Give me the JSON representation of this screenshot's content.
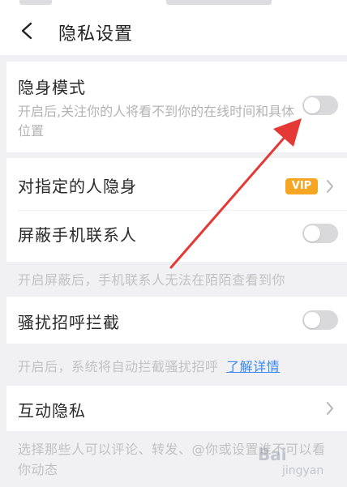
{
  "header": {
    "title": "隐私设置",
    "back_icon": "chevron-left-icon"
  },
  "items": {
    "incognito": {
      "label": "隐身模式",
      "desc": "开启后,关注你的人将看不到你的在线时间和具体位置",
      "toggle_on": false
    },
    "hide_from_people": {
      "label": "对指定的人隐身",
      "badge": "VIP",
      "badge_color": "#f5a623"
    },
    "block_contacts": {
      "label": "屏蔽手机联系人",
      "toggle_on": false,
      "note": "开启屏蔽后，手机联系人无法在陌陌查看到你"
    },
    "harassment": {
      "label": "骚扰招呼拦截",
      "toggle_on": false,
      "note": "开启后，系统将自动拦截骚扰招呼",
      "note_link": "了解详情",
      "link_color": "#3a88ee"
    },
    "interaction_privacy": {
      "label": "互动隐私",
      "note": "选择那些人可以评论、转发、@你或设置谁不可以看你动态"
    }
  },
  "annotation": {
    "arrow_color": "#e53935"
  },
  "watermark": {
    "text": "Bai",
    "sub": "jingyan"
  }
}
